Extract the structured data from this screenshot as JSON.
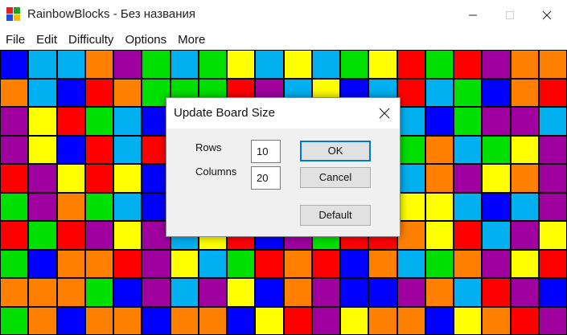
{
  "window": {
    "title": "RainbowBlocks - Без названия",
    "icon": "rainbow-blocks-app-icon",
    "controls": [
      "minimize-icon",
      "maximize-icon",
      "close-icon"
    ]
  },
  "menu": [
    "File",
    "Edit",
    "Difficulty",
    "Options",
    "More"
  ],
  "board": {
    "palette": {
      "B": "#0000ff",
      "C": "#00b0f0",
      "O": "#ff8000",
      "P": "#a000a0",
      "G": "#00e000",
      "Y": "#ffff00",
      "R": "#ff0000"
    },
    "rows": [
      "BCCOPGCGYCYCGYRGRPOO",
      "OCBROGGGRPCYBCRCGBOR",
      "PYRGCBGCRPGGBYCBGPPC",
      "PYBRCRPBYBYCRRGOCGYP",
      "RPYRYBOGOCYROYCOPYOP",
      "GPOGCBBCOGPCPCYYCBCP",
      "RGRPYPCYRBPGRROYRCPY",
      "GBOORPYCGRORBOCGOPYR",
      "OOOGBPCPYBOPBBPOCRPB",
      "GOBOOBOOBYRPYOOBYORP"
    ]
  },
  "dialog": {
    "title": "Update Board Size",
    "rows_label": "Rows",
    "rows_value": "10",
    "columns_label": "Columns",
    "columns_value": "20",
    "ok_label": "OK",
    "cancel_label": "Cancel",
    "default_label": "Default"
  }
}
